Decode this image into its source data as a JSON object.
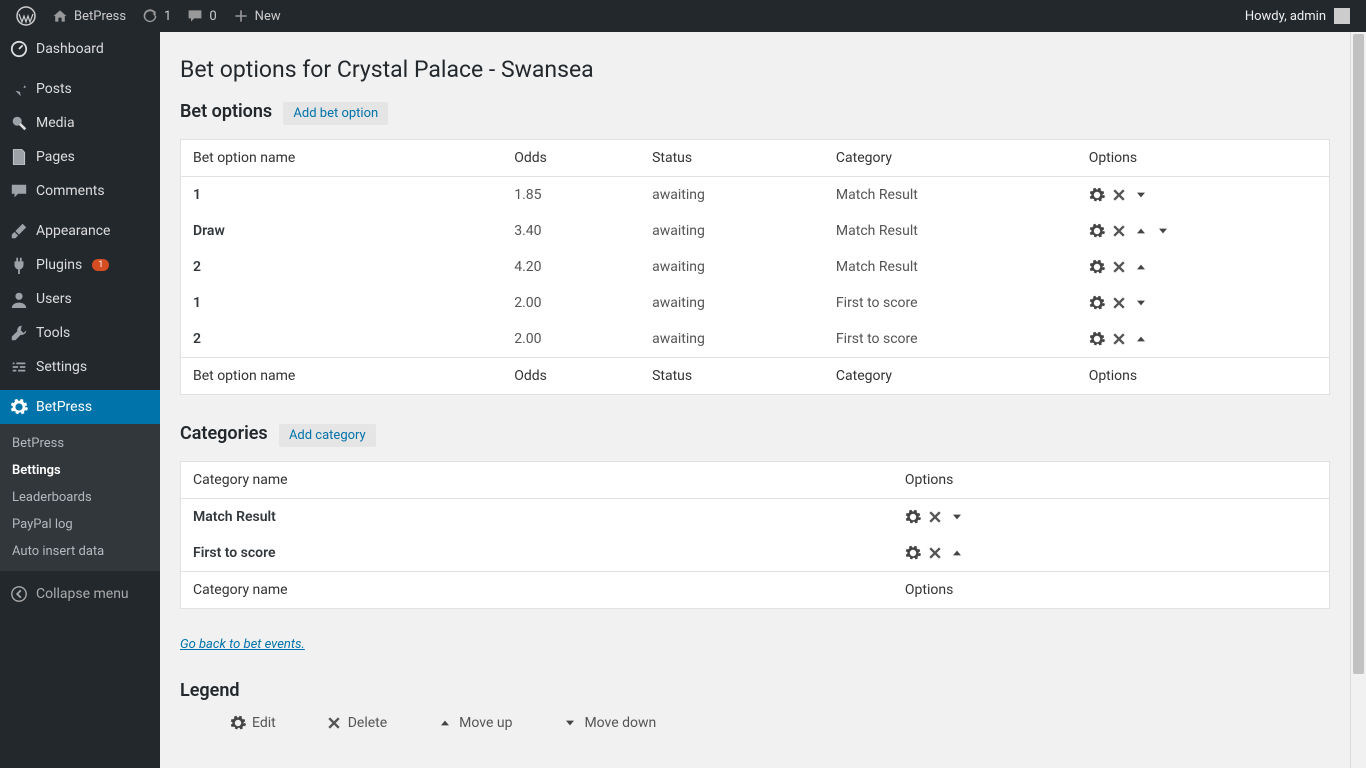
{
  "adminbar": {
    "site_name": "BetPress",
    "updates": "1",
    "comments": "0",
    "new_label": "New",
    "howdy": "Howdy, admin"
  },
  "sidebar": {
    "items": [
      {
        "label": "Dashboard"
      },
      {
        "label": "Posts"
      },
      {
        "label": "Media"
      },
      {
        "label": "Pages"
      },
      {
        "label": "Comments"
      },
      {
        "label": "Appearance"
      },
      {
        "label": "Plugins",
        "badge": "1"
      },
      {
        "label": "Users"
      },
      {
        "label": "Tools"
      },
      {
        "label": "Settings"
      },
      {
        "label": "BetPress"
      }
    ],
    "submenu": [
      {
        "label": "BetPress"
      },
      {
        "label": "Bettings"
      },
      {
        "label": "Leaderboards"
      },
      {
        "label": "PayPal log"
      },
      {
        "label": "Auto insert data"
      }
    ],
    "collapse": "Collapse menu"
  },
  "page": {
    "title": "Bet options for Crystal Palace - Swansea",
    "bet_options_heading": "Bet options",
    "add_bet_option": "Add bet option",
    "categories_heading": "Categories",
    "add_category": "Add category",
    "back_link": "Go back to bet events.",
    "legend_heading": "Legend"
  },
  "bet_columns": {
    "name": "Bet option name",
    "odds": "Odds",
    "status": "Status",
    "category": "Category",
    "options": "Options"
  },
  "bet_rows": [
    {
      "name": "1",
      "odds": "1.85",
      "status": "awaiting",
      "category": "Match Result",
      "up": false,
      "down": true
    },
    {
      "name": "Draw",
      "odds": "3.40",
      "status": "awaiting",
      "category": "Match Result",
      "up": true,
      "down": true
    },
    {
      "name": "2",
      "odds": "4.20",
      "status": "awaiting",
      "category": "Match Result",
      "up": true,
      "down": false
    },
    {
      "name": "1",
      "odds": "2.00",
      "status": "awaiting",
      "category": "First to score",
      "up": false,
      "down": true
    },
    {
      "name": "2",
      "odds": "2.00",
      "status": "awaiting",
      "category": "First to score",
      "up": true,
      "down": false
    }
  ],
  "cat_columns": {
    "name": "Category name",
    "options": "Options"
  },
  "cat_rows": [
    {
      "name": "Match Result",
      "up": false,
      "down": true
    },
    {
      "name": "First to score",
      "up": true,
      "down": false
    }
  ],
  "legend": {
    "edit": "Edit",
    "delete": "Delete",
    "move_up": "Move up",
    "move_down": "Move down"
  }
}
